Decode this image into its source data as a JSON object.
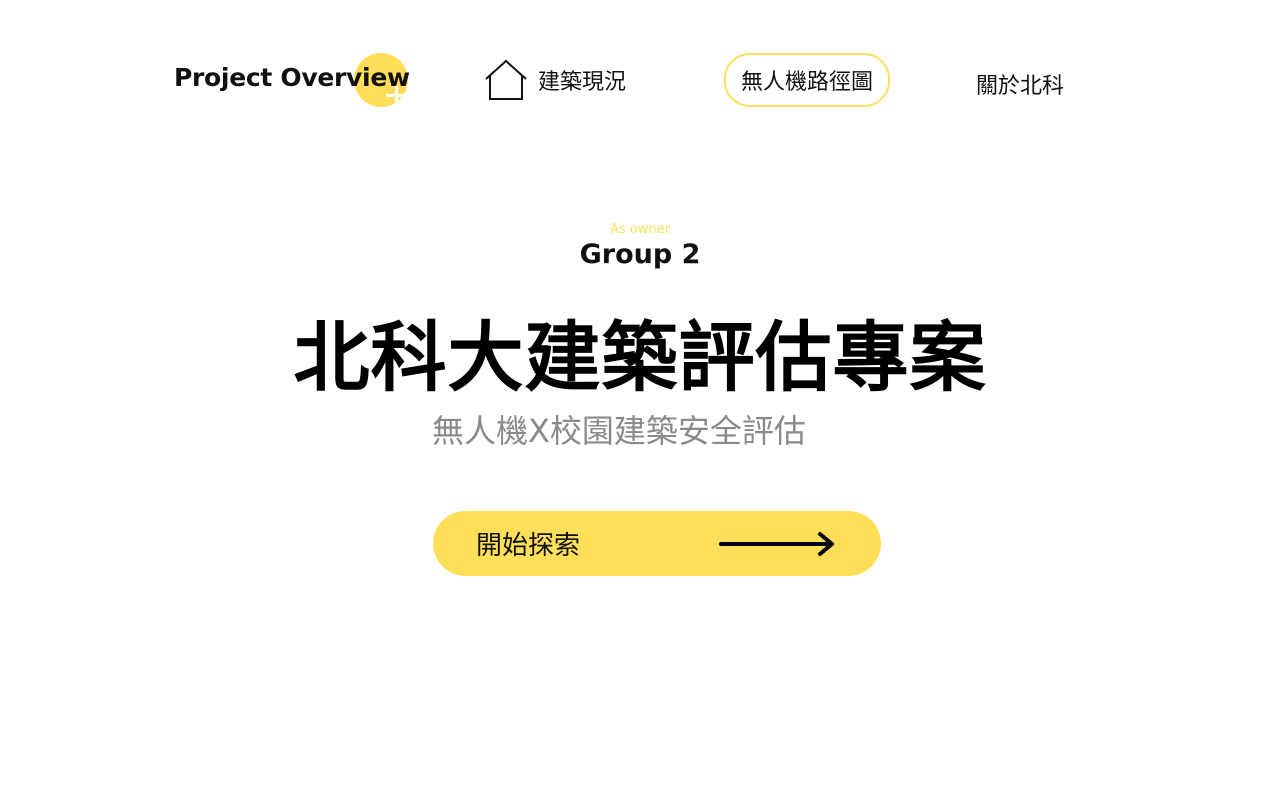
{
  "nav": {
    "brand": "Project Overview",
    "links": [
      {
        "label": "建築現況",
        "icon": "home-icon"
      },
      {
        "label": "無人機路徑圖",
        "active": true
      },
      {
        "label": "關於北科"
      }
    ]
  },
  "hero": {
    "owner_label": "As owner",
    "group": "Group 2",
    "title": "北科大建築評估專案",
    "subtitle": "無人機X校園建築安全評估",
    "cta_label": "開始探索",
    "cta_icon": "arrow-right-icon"
  },
  "colors": {
    "accent": "#FFDE59",
    "text": "#111111",
    "muted": "#8a8a8a",
    "background": "#ffffff"
  }
}
